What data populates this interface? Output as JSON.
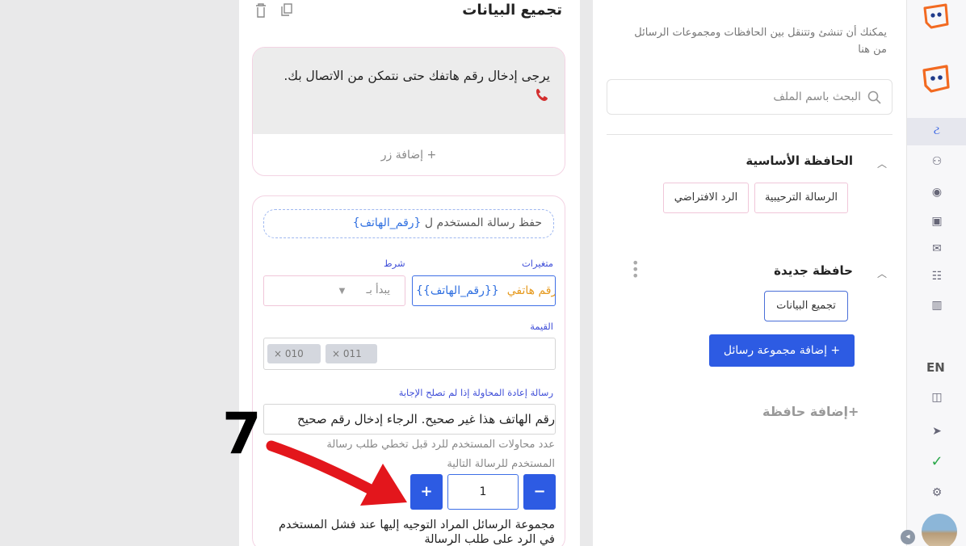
{
  "editor": {
    "title": "تجميع البيانات",
    "message_text": "يرجى إدخال رقم هاتفك حتى نتمكن من الاتصال بك.",
    "add_button": "+ إضافة زر",
    "save_response_prefix": "حفظ رسالة المستخدم ل",
    "save_response_token": "{رقم_الهاتف}",
    "variables_label": "متغيرات",
    "condition_label": "شرط",
    "variable_value": "{{رقم_الهاتف}}",
    "variable_hint": "رقم هاتفي",
    "condition_value": "يبدأ بـ",
    "value_label": "القيمة",
    "value_chips": [
      "010",
      "011"
    ],
    "retry_label": "رسالة إعادة المحاولة إذا لم تصلح الإجابة",
    "retry_value": "رقم الهاتف هذا غير صحيح. الرجاء إدخال رقم صحيح",
    "attempts_line1": "عدد محاولات المستخدم للرد قبل تخطي طلب رسالة",
    "attempts_line2": "المستخدم للرسالة التالية",
    "attempts_value": "1",
    "plus_label": "+",
    "minus_label": "−",
    "fail_redirect_label": "مجموعة الرسائل المراد التوجيه إليها عند فشل المستخدم في الرد على طلب الرسالة"
  },
  "folders": {
    "intro": "يمكنك أن تنشئ وتتنقل بين الحافظات ومجموعات الرسائل من هنا",
    "search_placeholder": "البحث باسم الملف",
    "main_folder": {
      "title": "الحافظة الأساسية",
      "items": [
        "الرسالة الترحيبية",
        "الرد الافتراضي"
      ]
    },
    "new_folder": {
      "title": "حافظة جديدة",
      "items": [
        "تجميع البيانات"
      ]
    },
    "add_group_button": "+ إضافة مجموعة رسائل",
    "add_folder": "+إضافة حافظة"
  },
  "rail": {
    "language": "EN"
  },
  "annotation": {
    "step_number": "7"
  },
  "colors": {
    "primary": "#2d5be3",
    "pink_border": "#f3d3e3",
    "label_blue": "#3f4ed8",
    "arrow_red": "#e3161c",
    "brand_orange": "#f26a21"
  }
}
